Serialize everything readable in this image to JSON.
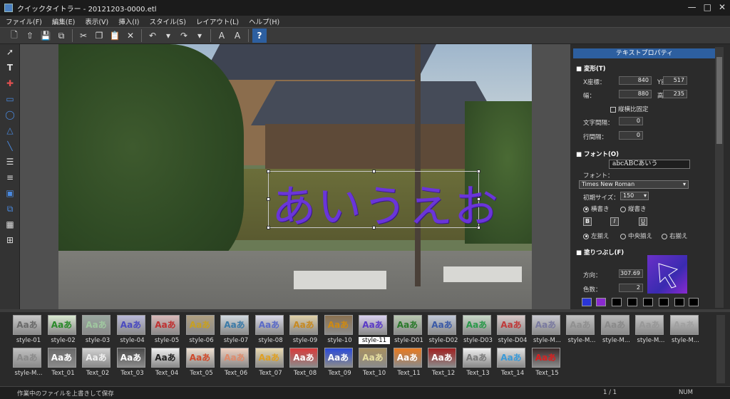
{
  "window": {
    "title": "クイックタイトラー - 20121203-0000.etl",
    "min": "—",
    "max": "□",
    "close": "✕"
  },
  "menu": [
    "ファイル(F)",
    "編集(E)",
    "表示(V)",
    "挿入(I)",
    "スタイル(S)",
    "レイアウト(L)",
    "ヘルプ(H)"
  ],
  "tooltip": "保存",
  "canvas": {
    "sample_text": "あいうえお"
  },
  "panel": {
    "title": "テキストプロパティ",
    "transform": {
      "header": "変形(T)",
      "x_label": "X座標：",
      "x": "840",
      "y_label": "Y座標：",
      "y": "517",
      "w_label": "幅：",
      "w": "880",
      "h_label": "高さ：",
      "h": "235",
      "aspect_label": "縦横比固定",
      "char_spacing_label": "文字間隔：",
      "char_spacing": "0",
      "line_spacing_label": "行間隔：",
      "line_spacing": "0"
    },
    "font": {
      "header": "フォント(O)",
      "preview": "abcABCあいう",
      "font_label": "フォント：",
      "font_name": "Times New Roman",
      "size_label": "初期サイズ：",
      "size": "150",
      "horizontal": "横書き",
      "vertical": "縦書き",
      "bold": "B",
      "italic": "I",
      "underline": "U",
      "align_left": "左揃え",
      "align_center": "中央揃え",
      "align_right": "右揃え"
    },
    "fill": {
      "header": "塗りつぶし(F)",
      "direction_label": "方向：",
      "direction": "307.69",
      "colors_label": "色数：",
      "colors": "2",
      "swatches": [
        "#2a35d8",
        "#8a2ad0",
        "#000000",
        "#000000",
        "#000000",
        "#000000",
        "#000000",
        "#000000"
      ]
    }
  },
  "styles": {
    "row1": [
      {
        "label": "style-01",
        "fg": "#6a6a6a",
        "bg": "#c8c8c8"
      },
      {
        "label": "style-02",
        "fg": "#2a8a2a",
        "bg": "#d8e8d0"
      },
      {
        "label": "style-03",
        "fg": "#a0c8a0",
        "bg": "#9aa8a0"
      },
      {
        "label": "style-04",
        "fg": "#4a4ac0",
        "bg": "#b8b8d8"
      },
      {
        "label": "style-05",
        "fg": "#c03030",
        "bg": "#d8b8b8"
      },
      {
        "label": "style-06",
        "fg": "#c8a020",
        "bg": "#b0a080"
      },
      {
        "label": "style-07",
        "fg": "#3a7aa8",
        "bg": "#d0d8e0"
      },
      {
        "label": "style-08",
        "fg": "#5a6ac8",
        "bg": "#d8d8e8"
      },
      {
        "label": "style-09",
        "fg": "#c88a20",
        "bg": "#e0d0a8"
      },
      {
        "label": "style-10",
        "fg": "#d08a10",
        "bg": "#8a7050"
      },
      {
        "label": "style-11",
        "fg": "#5a3ac8",
        "bg": "#d8d0f0"
      },
      {
        "label": "style-D01",
        "fg": "#2a7a2a",
        "bg": "#b8c8b0"
      },
      {
        "label": "style-D02",
        "fg": "#3a5aa8",
        "bg": "#c0c8d8"
      },
      {
        "label": "style-D03",
        "fg": "#2a9a4a",
        "bg": "#c8d8c8"
      },
      {
        "label": "style-D04",
        "fg": "#c03a3a",
        "bg": "#d8c8c8"
      },
      {
        "label": "style-M...",
        "fg": "#7a7aa0",
        "bg": "#c8c8d0"
      },
      {
        "label": "style-M...",
        "fg": "#909090",
        "bg": "#c0c0c0"
      },
      {
        "label": "style-M...",
        "fg": "#8a8a8a",
        "bg": "#b8b8b8"
      },
      {
        "label": "style-M...",
        "fg": "#989898",
        "bg": "#c4c4c4"
      },
      {
        "label": "style-M...",
        "fg": "#a0a0a0",
        "bg": "#cccccc"
      }
    ],
    "row2": [
      {
        "label": "style-M...",
        "fg": "#8a8a8a",
        "bg": "#c0c0c0"
      },
      {
        "label": "Text_01",
        "fg": "#ffffff",
        "bg": "#6a6a6a"
      },
      {
        "label": "Text_02",
        "fg": "#f0f0f0",
        "bg": "#d0d0d0"
      },
      {
        "label": "Text_03",
        "fg": "#ffffff",
        "bg": "#4a4a4a"
      },
      {
        "label": "Text_04",
        "fg": "#202020",
        "bg": "#f0f0f0"
      },
      {
        "label": "Text_05",
        "fg": "#d04a2a",
        "bg": "#f0e0d0"
      },
      {
        "label": "Text_06",
        "fg": "#e08a6a",
        "bg": "#f0d0c0"
      },
      {
        "label": "Text_07",
        "fg": "#e0a020",
        "bg": "#e8d8b0"
      },
      {
        "label": "Text_08",
        "fg": "#ffffff",
        "bg": "#d83a3a"
      },
      {
        "label": "Text_09",
        "fg": "#ffffff",
        "bg": "#2a4ad8"
      },
      {
        "label": "Text_10",
        "fg": "#e8e0a0",
        "bg": "#a89060"
      },
      {
        "label": "Text_11",
        "fg": "#ffffff",
        "bg": "#e87a20"
      },
      {
        "label": "Text_12",
        "fg": "#ffffff",
        "bg": "#a02020"
      },
      {
        "label": "Text_13",
        "fg": "#7a7a7a",
        "bg": "#f0f0f0"
      },
      {
        "label": "Text_14",
        "fg": "#3a9ad8",
        "bg": "#e0e0e0"
      },
      {
        "label": "Text_15",
        "fg": "#d82020",
        "bg": "#3a2a2a"
      }
    ],
    "selected": "style-11"
  },
  "status": {
    "message": "作業中のファイルを上書きして保存",
    "page": "1 / 1",
    "num": "NUM"
  }
}
